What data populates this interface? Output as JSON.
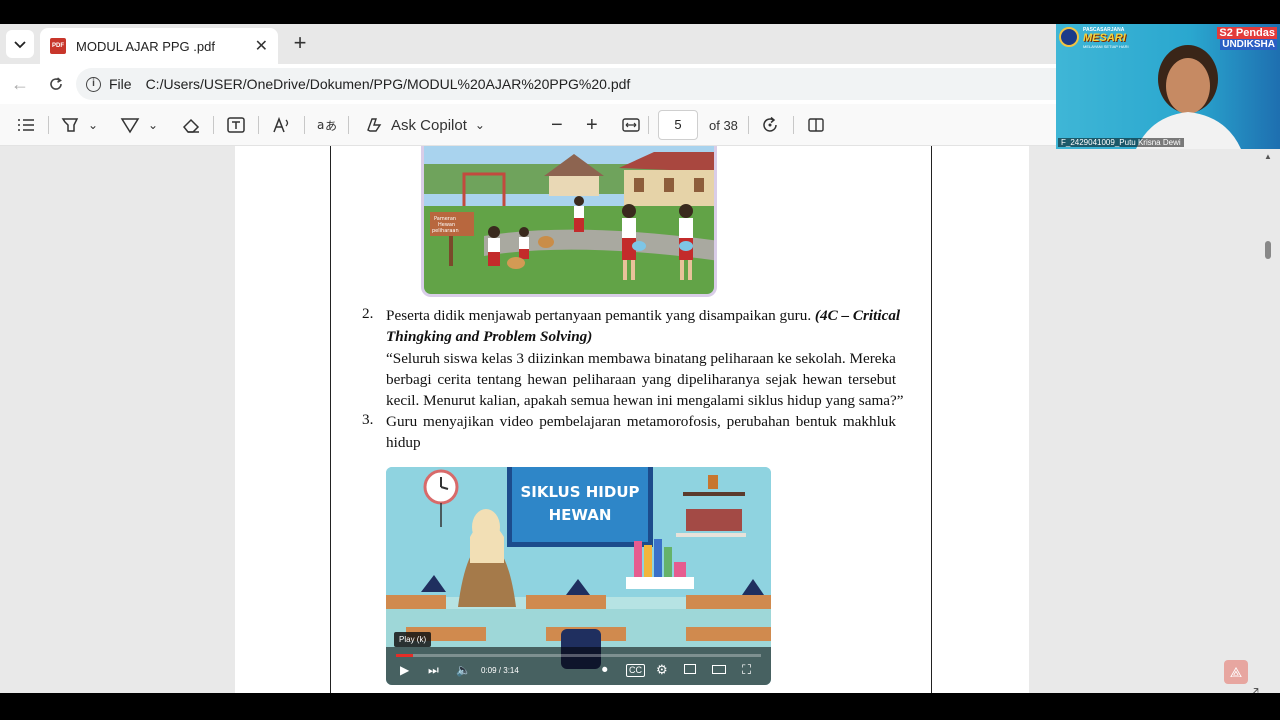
{
  "browser": {
    "tab_title": "MODUL AJAR PPG .pdf",
    "pdf_badge": "PDF",
    "address_prefix": "File",
    "url": "C:/Users/USER/OneDrive/Dokumen/PPG/MODUL%20AJAR%20PPG%20.pdf"
  },
  "pdf_toolbar": {
    "copilot_label": "Ask Copilot",
    "current_page": "5",
    "page_count_label": "of 38"
  },
  "document": {
    "illus1_sign": "Pameran Hewan peliharaan",
    "item2_num": "2.",
    "item2_line1_plain": "Peserta didik menjawab pertanyaan pemantik yang disampaikan guru. ",
    "item2_line1_emph": "(4C – Critical",
    "item2_line2_emph": "Thingking and Problem Solving)",
    "quote_line1": "“Seluruh siswa kelas 3 diizinkan membawa binatang peliharaan ke sekolah. Mereka",
    "quote_line2": "berbagi cerita tentang hewan peliharaan yang dipeliharanya sejak hewan tersebut",
    "quote_line3": "kecil. Menurut kalian, apakah semua hewan ini mengalami siklus hidup yang sama?”",
    "item3_num": "3.",
    "item3_line1": "Guru menyajikan video pembelajaran metamorofosis, perubahan bentuk makhluk",
    "item3_line2": "hidup"
  },
  "video": {
    "board_line1": "SIKLUS HIDUP",
    "board_line2": "HEWAN",
    "tooltip": "Play (k)",
    "time": "0:09 / 3:14",
    "progress": 0.046
  },
  "webcam": {
    "org_top": "PASCASARJANA",
    "org_name": "MESARI",
    "org_tag": "MELAYANI SETIAP HARI",
    "brand_line1": "S2 Pendas",
    "brand_line2": "UNDIKSHA",
    "participant": "F_2429041009_Putu Krisna Dewi"
  }
}
